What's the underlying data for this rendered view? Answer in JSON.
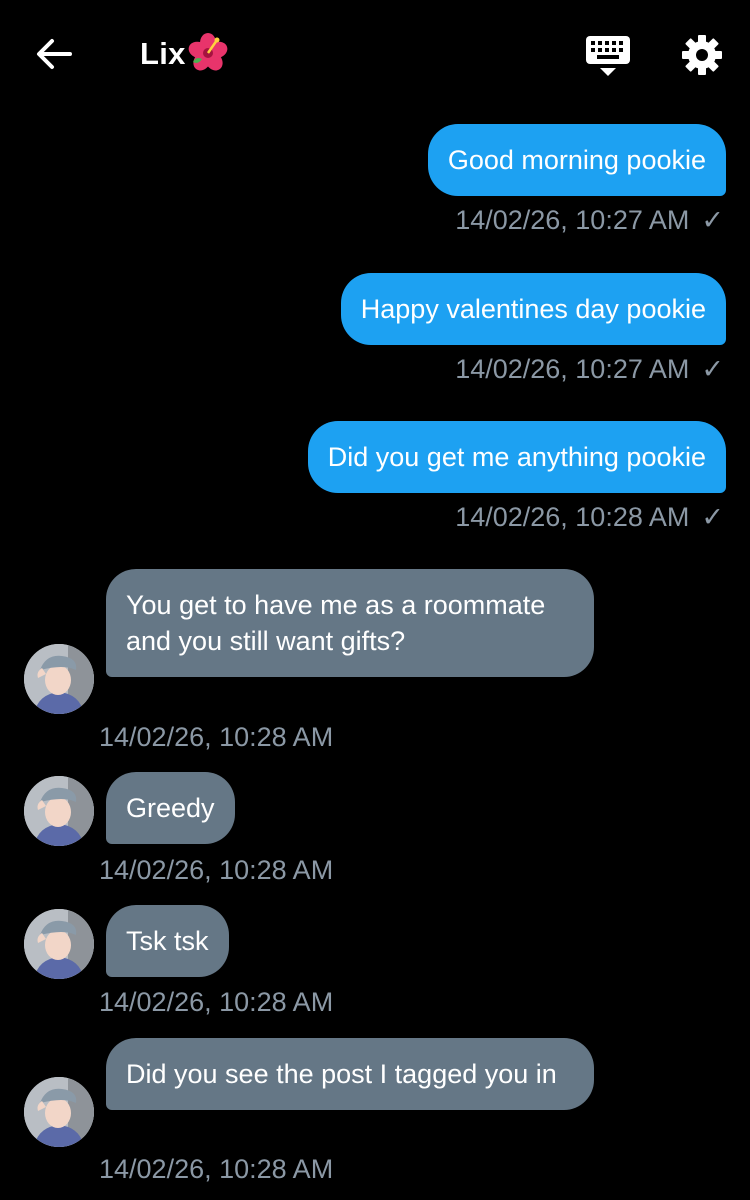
{
  "header": {
    "title": "Lix",
    "title_emoji": "🌺",
    "icons": [
      "back-arrow-icon",
      "keyboard-icon",
      "gear-icon"
    ]
  },
  "messages": [
    {
      "direction": "out",
      "text": "Good morning pookie",
      "time": "14/02/26, 10:27 AM",
      "status": "✓"
    },
    {
      "direction": "out",
      "text": "Happy valentines day pookie",
      "time": "14/02/26, 10:27 AM",
      "status": "✓"
    },
    {
      "direction": "out",
      "text": "Did you get me anything pookie",
      "time": "14/02/26, 10:28 AM",
      "status": "✓"
    },
    {
      "direction": "in",
      "text": "You get to have me as a roommate and you still want gifts?",
      "time": "14/02/26, 10:28 AM"
    },
    {
      "direction": "in",
      "text": "Greedy",
      "time": "14/02/26, 10:28 AM"
    },
    {
      "direction": "in",
      "text": "Tsk tsk",
      "time": "14/02/26, 10:28 AM"
    },
    {
      "direction": "in",
      "text": "Did you see the post I tagged you in",
      "time": "14/02/26, 10:28 AM"
    }
  ],
  "colors": {
    "background": "#000000",
    "outgoing_bubble": "#1da1f2",
    "incoming_bubble": "#657786",
    "timestamp": "#8b98a5"
  }
}
